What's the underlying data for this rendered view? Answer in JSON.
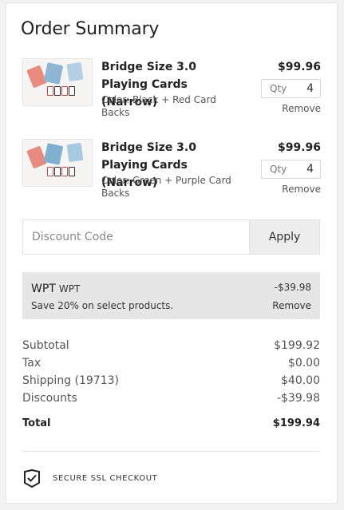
{
  "summary": {
    "title": "Order Summary"
  },
  "items": [
    {
      "name": "Bridge Size 3.0 Playing Cards (Narrow)",
      "variant": "Color: Black + Red Card Backs",
      "price": "$99.96",
      "qty_label": "Qty",
      "qty_value": "4",
      "remove_label": "Remove"
    },
    {
      "name": "Bridge Size 3.0 Playing Cards (Narrow)",
      "variant": "Color: Green + Purple Card Backs",
      "price": "$99.96",
      "qty_label": "Qty",
      "qty_value": "4",
      "remove_label": "Remove"
    }
  ],
  "discount": {
    "placeholder": "Discount Code",
    "apply_label": "Apply"
  },
  "promo": {
    "code": "WPT",
    "code_small": "WPT",
    "description": "Save 20% on select products.",
    "amount": "-$39.98",
    "remove_label": "Remove"
  },
  "totals": {
    "subtotal_label": "Subtotal",
    "subtotal": "$199.92",
    "tax_label": "Tax",
    "tax": "$0.00",
    "shipping_label": "Shipping (19713)",
    "shipping": "$40.00",
    "discounts_label": "Discounts",
    "discounts": "-$39.98",
    "total_label": "Total",
    "total": "$199.94"
  },
  "secure": {
    "label": "SECURE SSL CHECKOUT",
    "icon": "shield-check-icon"
  }
}
